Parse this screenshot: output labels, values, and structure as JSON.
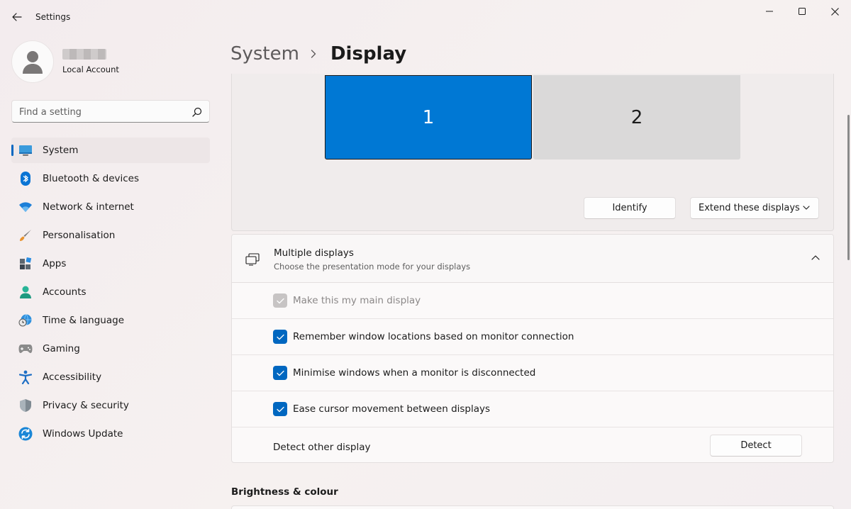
{
  "window": {
    "title": "Settings",
    "controls": [
      "minimize-icon",
      "maximize-icon",
      "close-icon"
    ]
  },
  "profile": {
    "account_type": "Local Account"
  },
  "search": {
    "placeholder": "Find a setting"
  },
  "sidebar": {
    "items": [
      {
        "label": "System",
        "icon": "monitor-icon",
        "active": true
      },
      {
        "label": "Bluetooth & devices",
        "icon": "bluetooth-icon"
      },
      {
        "label": "Network & internet",
        "icon": "wifi-icon"
      },
      {
        "label": "Personalisation",
        "icon": "brush-icon"
      },
      {
        "label": "Apps",
        "icon": "apps-icon"
      },
      {
        "label": "Accounts",
        "icon": "person-icon"
      },
      {
        "label": "Time & language",
        "icon": "globe-clock-icon"
      },
      {
        "label": "Gaming",
        "icon": "gamepad-icon"
      },
      {
        "label": "Accessibility",
        "icon": "accessibility-icon"
      },
      {
        "label": "Privacy & security",
        "icon": "shield-icon"
      },
      {
        "label": "Windows Update",
        "icon": "update-icon"
      }
    ]
  },
  "header": {
    "breadcrumb_parent": "System",
    "breadcrumb_current": "Display"
  },
  "arrangement": {
    "monitors": [
      {
        "label": "1",
        "selected": true
      },
      {
        "label": "2",
        "selected": false
      }
    ],
    "identify_label": "Identify",
    "mode_selected": "Extend these displays"
  },
  "multiple_displays": {
    "title": "Multiple displays",
    "subtitle": "Choose the presentation mode for your displays",
    "expanded": true,
    "options": [
      {
        "label": "Make this my main display",
        "checked": true,
        "disabled": true
      },
      {
        "label": "Remember window locations based on monitor connection",
        "checked": true,
        "disabled": false
      },
      {
        "label": "Minimise windows when a monitor is disconnected",
        "checked": true,
        "disabled": false
      },
      {
        "label": "Ease cursor movement between displays",
        "checked": true,
        "disabled": false
      }
    ],
    "detect_label": "Detect other display",
    "detect_button": "Detect"
  },
  "brightness": {
    "heading": "Brightness & colour"
  },
  "colors": {
    "accent": "#0078d4",
    "accent_dark": "#0067c0",
    "background": "#f3ecee",
    "card": "#fbf9f9"
  }
}
